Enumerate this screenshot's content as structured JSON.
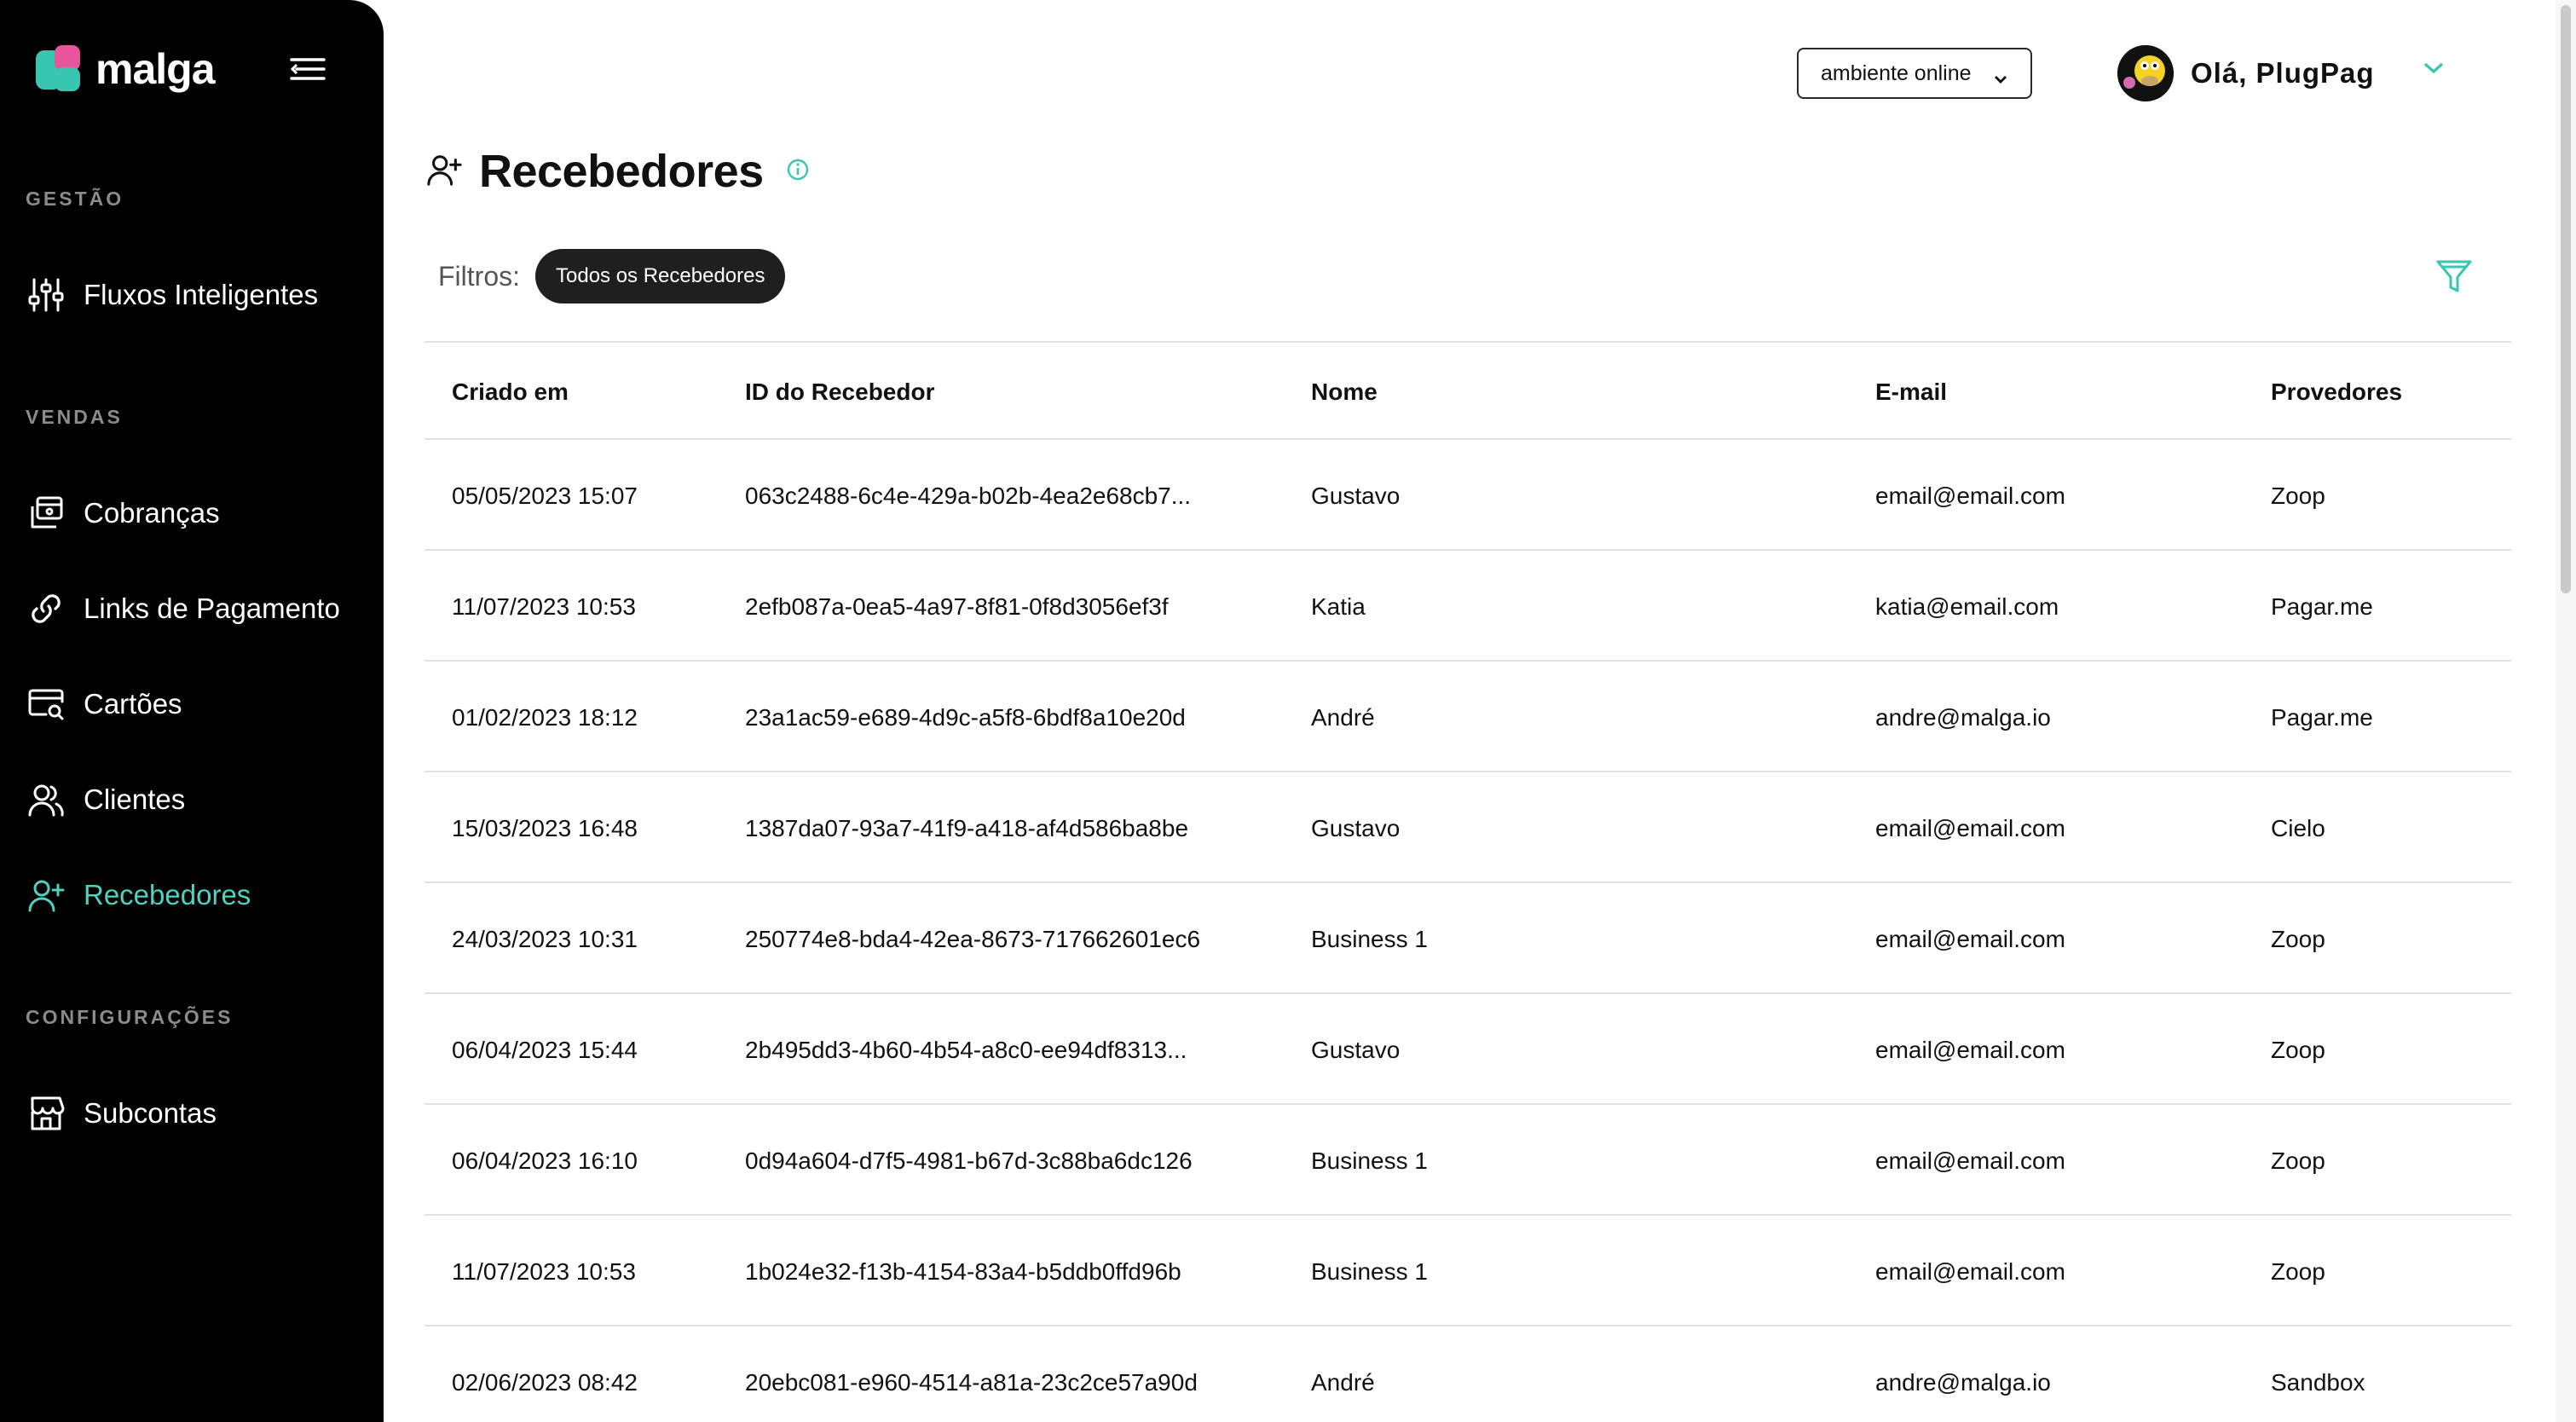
{
  "sidebar": {
    "logo_text": "malga",
    "sections": [
      {
        "label": "GESTÃO"
      },
      {
        "label": "VENDAS"
      },
      {
        "label": "CONFIGURAÇÕES"
      }
    ],
    "items": [
      {
        "label": "Fluxos Inteligentes",
        "icon": "sliders-icon"
      },
      {
        "label": "Cobranças",
        "icon": "charges-icon"
      },
      {
        "label": "Links de Pagamento",
        "icon": "link-icon"
      },
      {
        "label": "Cartões",
        "icon": "card-search-icon"
      },
      {
        "label": "Clientes",
        "icon": "users-icon"
      },
      {
        "label": "Recebedores",
        "icon": "user-plus-icon",
        "active": true
      },
      {
        "label": "Subcontas",
        "icon": "store-icon"
      }
    ]
  },
  "header": {
    "environment": "ambiente online",
    "greeting": "Olá, PlugPag"
  },
  "page": {
    "title": "Recebedores",
    "filters_label": "Filtros:",
    "active_filter": "Todos os Recebedores"
  },
  "table": {
    "columns": [
      "Criado em",
      "ID do Recebedor",
      "Nome",
      "E-mail",
      "Provedores"
    ],
    "rows": [
      [
        "05/05/2023 15:07",
        "063c2488-6c4e-429a-b02b-4ea2e68cb7...",
        "Gustavo",
        "email@email.com",
        "Zoop"
      ],
      [
        "11/07/2023 10:53",
        "2efb087a-0ea5-4a97-8f81-0f8d3056ef3f",
        "Katia",
        "katia@email.com",
        "Pagar.me"
      ],
      [
        "01/02/2023 18:12",
        "23a1ac59-e689-4d9c-a5f8-6bdf8a10e20d",
        "André",
        "andre@malga.io",
        "Pagar.me"
      ],
      [
        "15/03/2023 16:48",
        "1387da07-93a7-41f9-a418-af4d586ba8be",
        "Gustavo",
        "email@email.com",
        "Cielo"
      ],
      [
        "24/03/2023 10:31",
        "250774e8-bda4-42ea-8673-717662601ec6",
        "Business 1",
        "email@email.com",
        "Zoop"
      ],
      [
        "06/04/2023 15:44",
        "2b495dd3-4b60-4b54-a8c0-ee94df8313...",
        "Gustavo",
        "email@email.com",
        "Zoop"
      ],
      [
        "06/04/2023 16:10",
        "0d94a604-d7f5-4981-b67d-3c88ba6dc126",
        "Business 1",
        "email@email.com",
        "Zoop"
      ],
      [
        "11/07/2023 10:53",
        "1b024e32-f13b-4154-83a4-b5ddb0ffd96b",
        "Business 1",
        "email@email.com",
        "Zoop"
      ],
      [
        "02/06/2023 08:42",
        "20ebc081-e960-4514-a81a-23c2ce57a90d",
        "André",
        "andre@malga.io",
        "Sandbox"
      ]
    ]
  },
  "colors": {
    "accent": "#4fd1bf",
    "sidebar_bg": "#000000",
    "chip_bg": "#1f1f1f"
  }
}
